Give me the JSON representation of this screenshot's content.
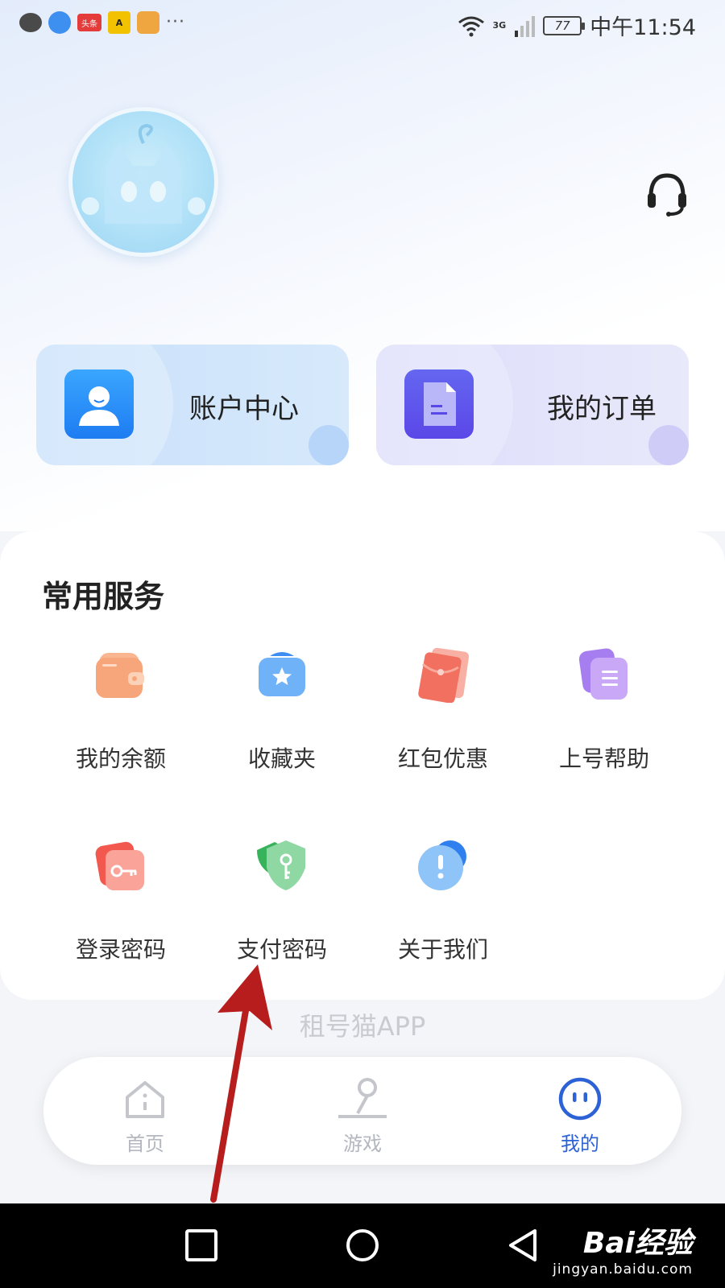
{
  "status_bar": {
    "time": "中午11:54",
    "battery": "77",
    "network": "3G",
    "news_badge": "头条",
    "more": "···"
  },
  "quick_cards": [
    {
      "label": "账户中心",
      "icon": "user-icon"
    },
    {
      "label": "我的订单",
      "icon": "document-icon"
    }
  ],
  "services": {
    "title": "常用服务",
    "items": [
      {
        "label": "我的余额",
        "icon": "wallet-icon",
        "color": "#f7a57b"
      },
      {
        "label": "收藏夹",
        "icon": "favorites-star-icon",
        "color": "#5ea8f6"
      },
      {
        "label": "红包优惠",
        "icon": "red-envelope-icon",
        "color": "#f2705f"
      },
      {
        "label": "上号帮助",
        "icon": "help-document-icon",
        "color": "#b07cf0"
      },
      {
        "label": "登录密码",
        "icon": "login-key-icon",
        "color": "#f46d62"
      },
      {
        "label": "支付密码",
        "icon": "payment-shield-key-icon",
        "color": "#5cc27a"
      },
      {
        "label": "关于我们",
        "icon": "about-info-icon",
        "color": "#4f9cf0"
      }
    ]
  },
  "footer": {
    "brand": "租号猫APP"
  },
  "tabbar": {
    "tabs": [
      {
        "label": "首页",
        "icon": "home-icon",
        "active": false
      },
      {
        "label": "游戏",
        "icon": "game-icon",
        "active": false
      },
      {
        "label": "我的",
        "icon": "profile-face-icon",
        "active": true
      }
    ],
    "active_color": "#2c62d6"
  },
  "watermark": {
    "brand": "Bai经验",
    "url": "jingyan.baidu.com"
  }
}
